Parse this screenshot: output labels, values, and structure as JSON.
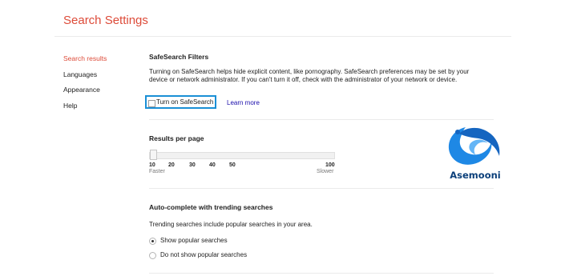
{
  "page": {
    "title": "Search Settings"
  },
  "sidebar": {
    "items": [
      {
        "label": "Search results",
        "active": true
      },
      {
        "label": "Languages",
        "active": false
      },
      {
        "label": "Appearance",
        "active": false
      },
      {
        "label": "Help",
        "active": false
      }
    ]
  },
  "safesearch": {
    "heading": "SafeSearch Filters",
    "description": "Turning on SafeSearch helps hide explicit content, like pornography. SafeSearch preferences may be set by your device or network administrator. If you can't turn it off, check with the administrator of your network or device.",
    "checkbox_label": "Turn on SafeSearch",
    "checked": false,
    "learn_more": "Learn more",
    "highlight_color": "#1a8fd6"
  },
  "results_per_page": {
    "heading": "Results per page",
    "ticks": [
      "10",
      "20",
      "30",
      "40",
      "50",
      "100"
    ],
    "min_label": "Faster",
    "max_label": "Slower",
    "selected": "10"
  },
  "autocomplete": {
    "heading": "Auto-complete with trending searches",
    "description": "Trending searches include popular searches in your area.",
    "options": [
      {
        "label": "Show popular searches",
        "selected": true
      },
      {
        "label": "Do not show popular searches",
        "selected": false
      }
    ]
  },
  "watermark": {
    "text": "Asemooni",
    "icon": "swirl-logo-icon",
    "color": "#0b3f7a"
  },
  "colors": {
    "accent": "#dd4b39",
    "link": "#1a0dab"
  }
}
